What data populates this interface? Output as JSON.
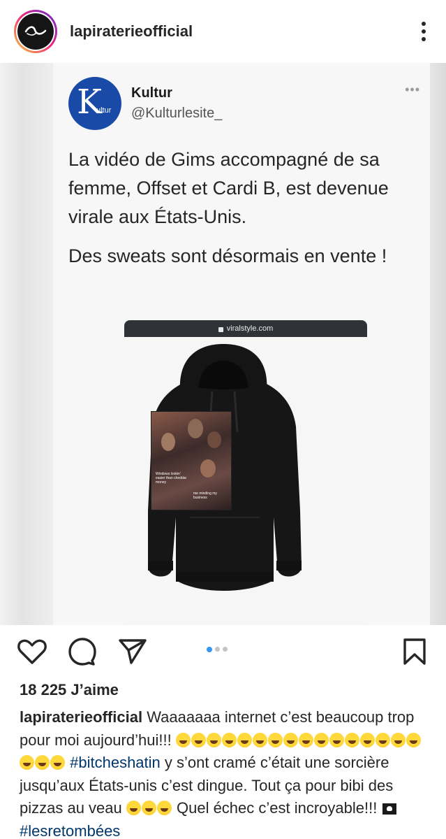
{
  "post": {
    "username": "lapiraterieofficial"
  },
  "tweet": {
    "logo_letter": "K",
    "logo_sub": "ultur",
    "name": "Kultur",
    "handle": "@Kulturlesite_",
    "more": "•••",
    "text1": "La vidéo de Gims accompagné de sa femme, Offset et Cardi B, est devenue virale aux États-Unis.",
    "text2": "Des sweats sont désormais en vente !"
  },
  "browser": {
    "url": "viralstyle.com"
  },
  "hoodie_print": {
    "caption1": "Windows lookin' easier than cheddar money",
    "caption2": "me minding my business"
  },
  "carousel": {
    "total": 3,
    "active": 1
  },
  "likes": {
    "label": "18 225 J’aime"
  },
  "caption": {
    "username": "lapiraterieofficial",
    "part1": " Waaaaaaa internet c’est beaucoup trop pour moi aujourd’hui!!! ",
    "hashtag1": "#bitcheshatin",
    "part2": " y s’ont cramé c’était une sorcière jusqu’aux États-unis c’est dingue. Tout ça pour bibi des pizzas au veau ",
    "part3": " Quel échec c’est incroyable!!! ",
    "hashtag2": "#lesretombées",
    "emoji_name": "rolling-on-floor-laughing",
    "flag_name": "pirate-flag"
  },
  "colors": {
    "text": "#262626",
    "link": "#00376b",
    "carousel_active": "#3897f0",
    "kultur_blue": "#1a4aa8"
  }
}
